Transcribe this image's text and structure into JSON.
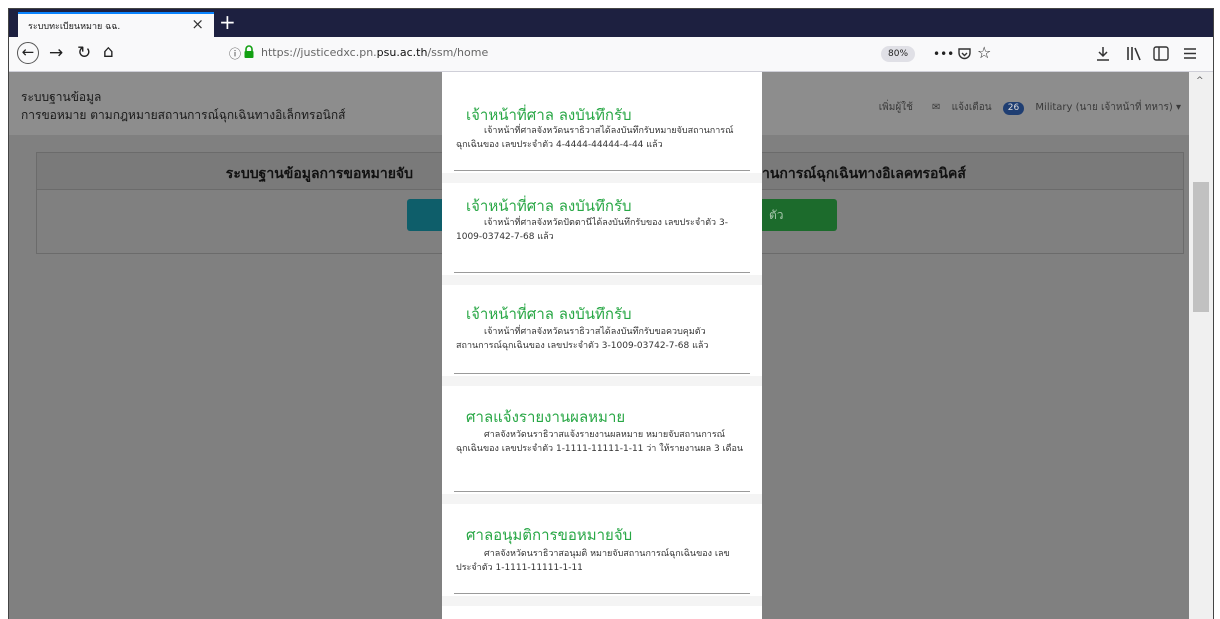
{
  "browser": {
    "tab_title": "ระบบทะเบียนหมาย ฉฉ.",
    "tab_close": "×",
    "new_tab": "+",
    "url_prefix": "https://justicedxc.pn.",
    "url_domain": "psu.ac.th",
    "url_path": "/ssm/home",
    "zoom": "80%",
    "more": "•••"
  },
  "header": {
    "brand_line1": "ระบบฐานข้อมูล",
    "brand_line2": "การขอหมาย ตามกฎหมายสถานการณ์ฉุกเฉินทางอิเล็กทรอนิกส์",
    "add_user": "เพิ่มผู้ใช้",
    "notifications_label": "แจ้งเตือน",
    "notifications_count": "26",
    "user": "Military (นาย เจ้าหน้าที่ ทหาร) ▾"
  },
  "main": {
    "card_title_left": "ระบบฐานข้อมูลการขอหมายจับ",
    "card_title_right": "านการณ์ฉุกเฉินทางอิเลคทรอนิคส์",
    "green_button_partial": "ตัว"
  },
  "notifications": [
    {
      "title": "เจ้าหน้าที่ศาล ลงบันทึกรับ",
      "body": "เจ้าหน้าที่ศาลจังหวัดนราธิวาสได้ลงบันทึกรับหมายจับสถานการณ์ฉุกเฉินของ เลขประจำตัว 4-4444-44444-4-44 แล้ว"
    },
    {
      "title": "เจ้าหน้าที่ศาล ลงบันทึกรับ",
      "body": "เจ้าหน้าที่ศาลจังหวัดปัตตานีได้ลงบันทึกรับของ เลขประจำตัว 3-1009-03742-7-68 แล้ว"
    },
    {
      "title": "เจ้าหน้าที่ศาล ลงบันทึกรับ",
      "body": "เจ้าหน้าที่ศาลจังหวัดนราธิวาสได้ลงบันทึกรับขอควบคุมตัวสถานการณ์ฉุกเฉินของ เลขประจำตัว 3-1009-03742-7-68 แล้ว"
    },
    {
      "title": "ศาลแจ้งรายงานผลหมาย",
      "body": "ศาลจังหวัดนราธิวาสแจ้งรายงานผลหมาย หมายจับสถานการณ์ฉุกเฉินของ เลขประจำตัว 1-1111-11111-1-11 ว่า ให้รายงานผล 3 เดือน"
    },
    {
      "title": "ศาลอนุมติการขอหมายจับ",
      "body": "ศาลจังหวัดนราธิวาสอนุมติ หมายจับสถานการณ์ฉุกเฉินของ เลขประจำตัว 1-1111-11111-1-11"
    }
  ],
  "colors": {
    "title_green": "#28a745",
    "tabstrip": "#1d2040",
    "overlay_gray": "#808080"
  }
}
